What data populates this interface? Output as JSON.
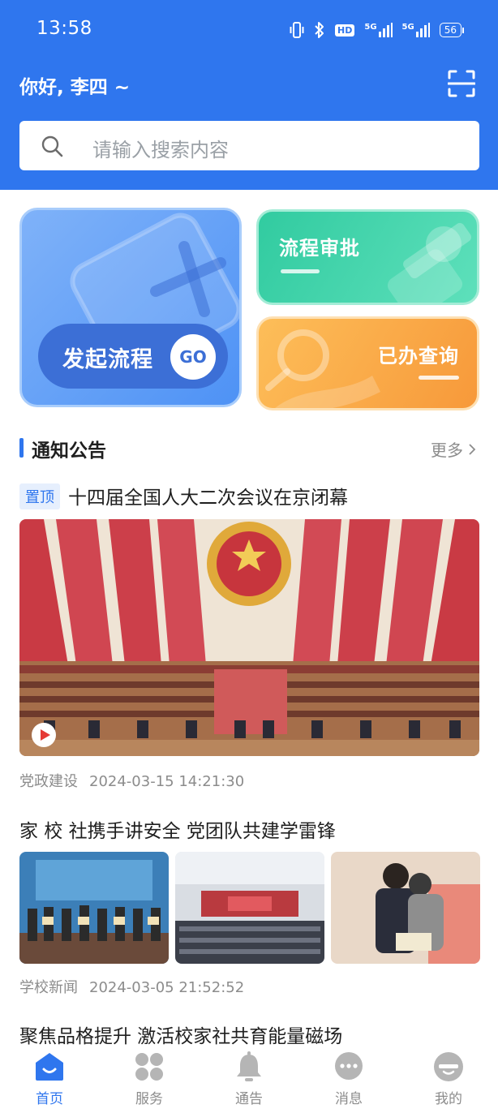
{
  "status_bar": {
    "time": "13:58",
    "hd_badge": "HD",
    "signal_1": "5G",
    "signal_2": "5G",
    "battery": "56"
  },
  "header": {
    "greeting": "你好, 李四 ~",
    "scan_icon": "scan-icon",
    "background_color": "#2f76ee"
  },
  "search": {
    "placeholder": "请输入搜索内容",
    "icon": "search-icon"
  },
  "quick_actions": {
    "start_process": {
      "label": "发起流程",
      "go": "GO"
    },
    "approval": {
      "label": "流程审批"
    },
    "handled_query": {
      "label": "已办查询"
    }
  },
  "notices": {
    "title": "通知公告",
    "more": "更多",
    "items": [
      {
        "tag": "置顶",
        "title": "十四届全国人大二次会议在京闭幕",
        "category": "党政建设",
        "datetime": "2024-03-15 14:21:30"
      },
      {
        "title": "家 校 社携手讲安全 党团队共建学雷锋",
        "category": "学校新闻",
        "datetime": "2024-03-05 21:52:52"
      },
      {
        "title": "聚焦品格提升 激活校家社共育能量磁场"
      }
    ]
  },
  "tabbar": {
    "active_color": "#2f76ee",
    "items": [
      {
        "label": "首页",
        "icon": "home-icon"
      },
      {
        "label": "服务",
        "icon": "services-icon"
      },
      {
        "label": "通告",
        "icon": "bell-icon"
      },
      {
        "label": "消息",
        "icon": "message-icon"
      },
      {
        "label": "我的",
        "icon": "profile-icon"
      }
    ]
  }
}
